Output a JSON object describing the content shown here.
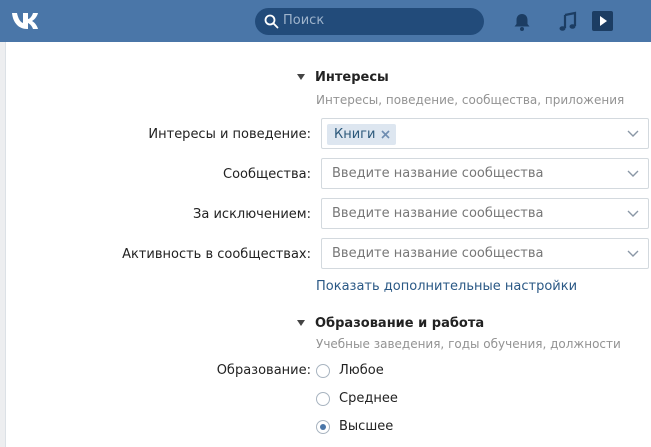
{
  "header": {
    "logo": "vk-logo-icon",
    "search_placeholder": "Поиск"
  },
  "interests": {
    "title": "Интересы",
    "subtitle": "Интересы, поведение, сообщества, приложения",
    "rows": [
      {
        "label": "Интересы и поведение:",
        "chip": "Книги"
      },
      {
        "label": "Сообщества:",
        "placeholder": "Введите название сообщества"
      },
      {
        "label": "За исключением:",
        "placeholder": "Введите название сообщества"
      },
      {
        "label": "Активность в сообществах:",
        "placeholder": "Введите название сообщества"
      }
    ],
    "more_link": "Показать дополнительные настройки"
  },
  "education": {
    "title": "Образование и работа",
    "subtitle": "Учебные заведения, годы обучения, должности",
    "label": "Образование:",
    "options": [
      {
        "label": "Любое",
        "selected": false
      },
      {
        "label": "Среднее",
        "selected": false
      },
      {
        "label": "Высшее",
        "selected": true
      }
    ]
  },
  "colors": {
    "header_bg": "#4a76a8",
    "accent": "#4a76a8",
    "link": "#2a5885"
  }
}
